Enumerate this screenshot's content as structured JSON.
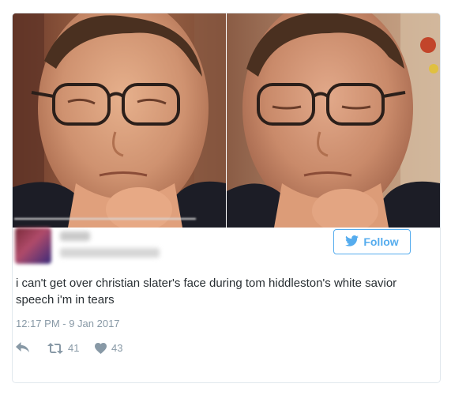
{
  "tweet": {
    "follow_label": "Follow",
    "text": "i can't get over christian slater's face during tom hiddleston's white savior speech i'm in tears",
    "timestamp": "12:17 PM - 9 Jan 2017",
    "retweets": "41",
    "likes": "43"
  },
  "colors": {
    "accent": "#55acee",
    "text": "#292f33",
    "muted": "#8899a6",
    "border": "#e1e8ed"
  },
  "icons": {
    "follow": "bird-icon",
    "reply": "reply-icon",
    "retweet": "retweet-icon",
    "like": "heart-icon"
  }
}
